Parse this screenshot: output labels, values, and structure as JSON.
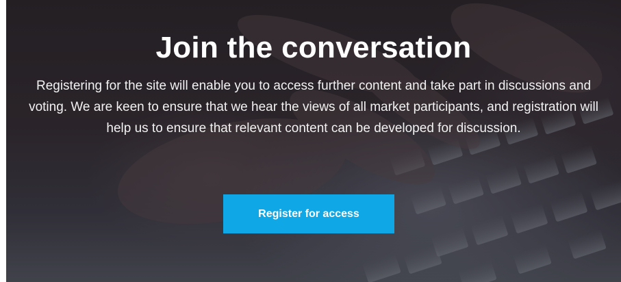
{
  "hero": {
    "title": "Join the conversation",
    "description": "Registering for the site will enable you to access further content and take part in discussions and voting. We are keen to ensure that we hear the views of all market participants, and registration will help us to ensure that relevant content can be developed for discussion.",
    "cta_label": "Register for access",
    "background_image": "hands-typing-on-laptop-keyboard"
  },
  "colors": {
    "cta_background": "#10a7e6",
    "text": "#ffffff"
  }
}
